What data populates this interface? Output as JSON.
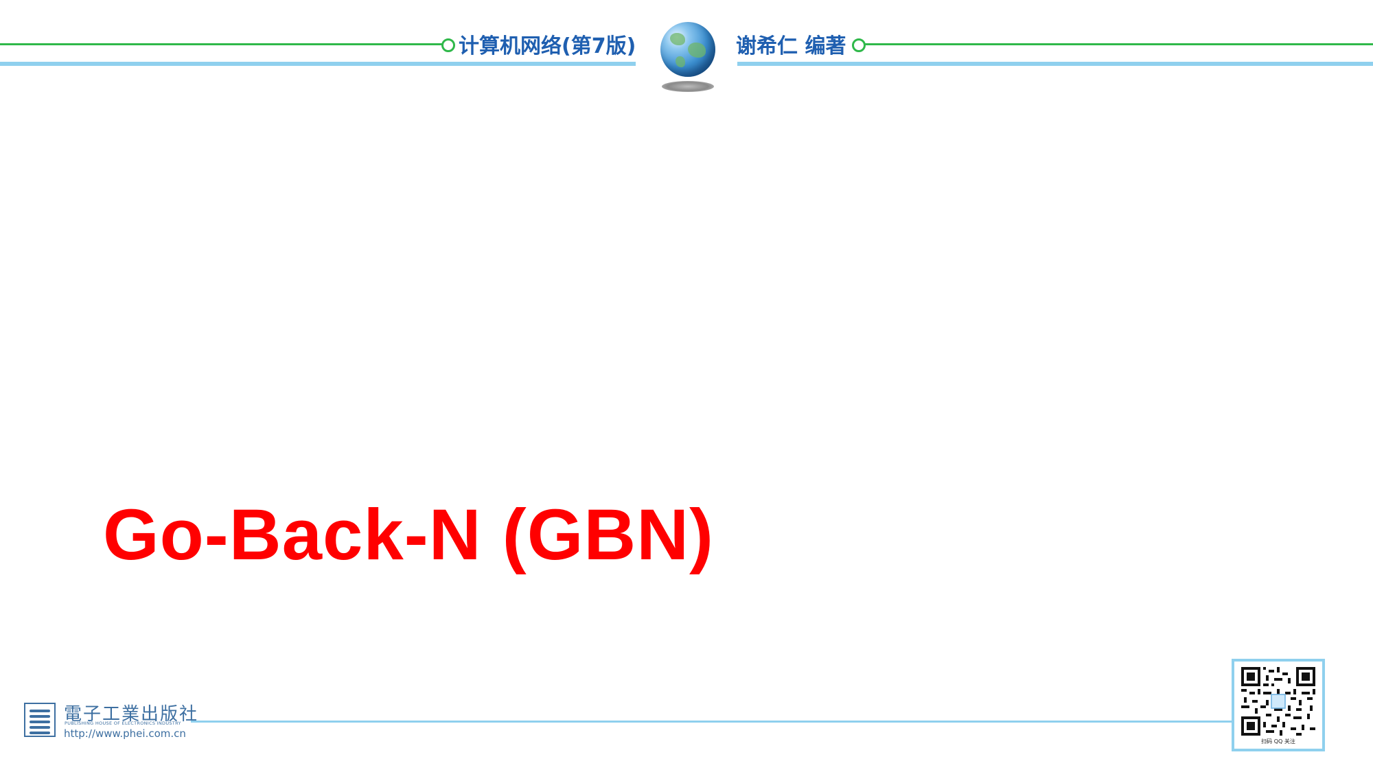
{
  "header": {
    "book_title": "计算机网络(第7版)",
    "author": "谢希仁 编著"
  },
  "slide": {
    "title": "Go-Back-N (GBN)"
  },
  "footer": {
    "publisher_cn": "電子工業出版社",
    "publisher_en": "PUBLISHING HOUSE OF ELECTRONICS INDUSTRY",
    "publisher_url": "http://www.phei.com.cn",
    "qr_caption": "扫码 QQ 关注"
  },
  "icons": {
    "globe": "globe-icon",
    "publisher_logo": "publisher-logo-icon",
    "qr": "qr-code-icon"
  },
  "colors": {
    "title": "#ff0000",
    "header_text": "#1f5fb0",
    "green_line": "#2fb84a",
    "blue_line": "#8fd0ee",
    "publisher": "#3d6fa1"
  }
}
